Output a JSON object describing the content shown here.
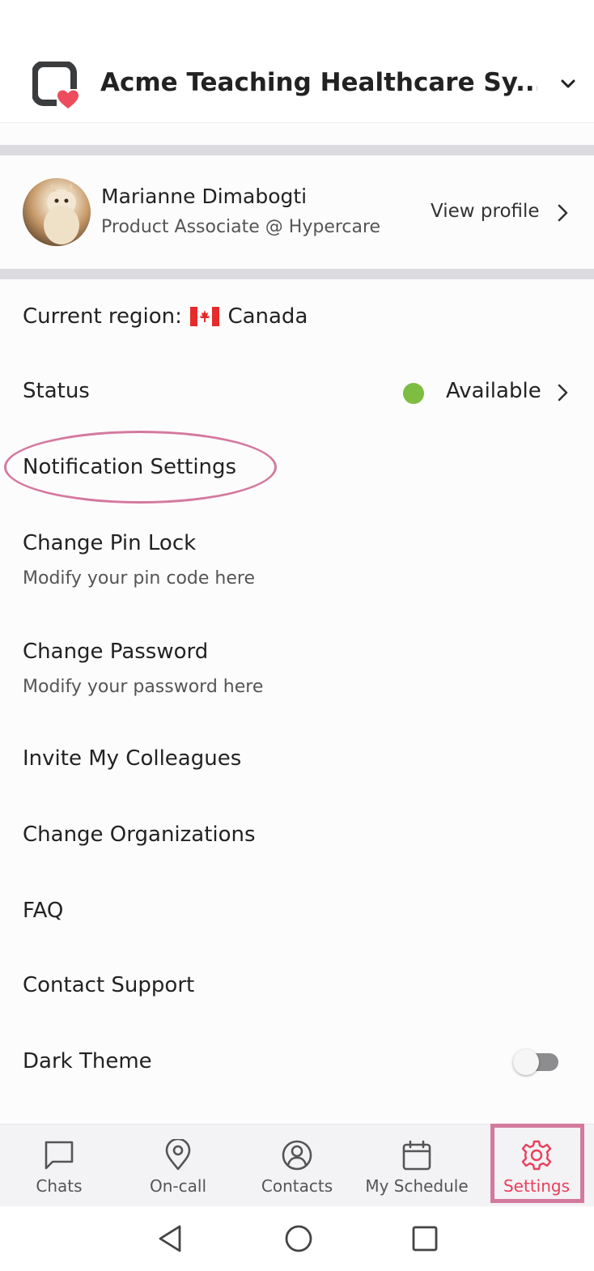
{
  "header": {
    "org_name": "Acme Teaching Healthcare Sy...",
    "logo_icon": "hypercare-logo-icon",
    "dropdown_icon": "chevron-down-icon"
  },
  "profile": {
    "name": "Marianne Dimabogti",
    "subtitle": "Product Associate @ Hypercare",
    "view_profile_label": "View profile"
  },
  "menu": {
    "region_label": "Current region:",
    "region_flag": "canada-flag-icon",
    "region_value": "Canada",
    "status_label": "Status",
    "status_value": "Available",
    "status_color": "#7cbd42",
    "notification_settings": "Notification Settings",
    "pin_lock_title": "Change Pin Lock",
    "pin_lock_sub": "Modify your pin code here",
    "password_title": "Change Password",
    "password_sub": "Modify your password here",
    "invite": "Invite My Colleagues",
    "change_org": "Change Organizations",
    "faq": "FAQ",
    "contact_support": "Contact Support",
    "dark_theme": "Dark Theme",
    "dark_theme_enabled": false
  },
  "tabs": [
    {
      "label": "Chats",
      "icon": "chat-icon",
      "active": false
    },
    {
      "label": "On-call",
      "icon": "location-pin-icon",
      "active": false
    },
    {
      "label": "Contacts",
      "icon": "contacts-icon",
      "active": false
    },
    {
      "label": "My Schedule",
      "icon": "calendar-icon",
      "active": false
    },
    {
      "label": "Settings",
      "icon": "gear-icon",
      "active": true
    }
  ],
  "colors": {
    "accent": "#e8405a",
    "annotation": "#d4799e"
  }
}
